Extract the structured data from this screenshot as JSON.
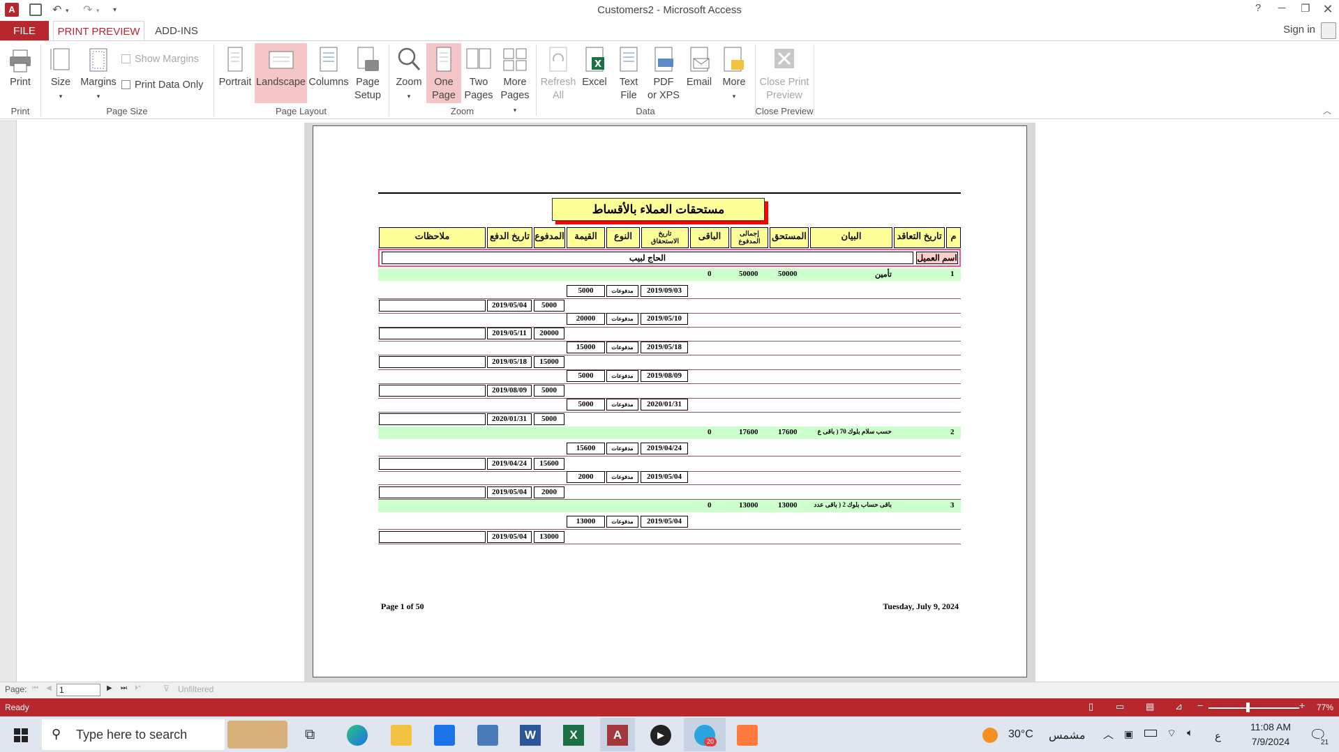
{
  "window": {
    "title": "Customers2 - Microsoft Access",
    "help": "?",
    "sign_in": "Sign in"
  },
  "tabs": [
    {
      "label": "FILE"
    },
    {
      "label": "PRINT PREVIEW"
    },
    {
      "label": "ADD-INS"
    }
  ],
  "ribbon": {
    "print": "Print",
    "size": "Size",
    "margins": "Margins",
    "show_margins": "Show Margins",
    "print_data_only": "Print Data Only",
    "portrait": "Portrait",
    "landscape": "Landscape",
    "columns": "Columns",
    "page_setup_1": "Page",
    "page_setup_2": "Setup",
    "zoom": "Zoom",
    "one_page_1": "One",
    "one_page_2": "Page",
    "two_pages_1": "Two",
    "two_pages_2": "Pages",
    "more_pages_1": "More",
    "more_pages_2": "Pages",
    "refresh_1": "Refresh",
    "refresh_2": "All",
    "excel": "Excel",
    "text_file_1": "Text",
    "text_file_2": "File",
    "pdf_1": "PDF",
    "pdf_2": "or XPS",
    "email": "Email",
    "more": "More",
    "close_1": "Close Print",
    "close_2": "Preview",
    "groups": {
      "print": "Print",
      "page_size": "Page Size",
      "page_layout": "Page Layout",
      "zoom": "Zoom",
      "data": "Data",
      "close_preview": "Close Preview"
    }
  },
  "report": {
    "title": "مستحقات العملاء بالأقساط",
    "headers": {
      "m": "م",
      "contract_date": "تاريخ التعاقد",
      "statement": "البيان",
      "due": "المستحق",
      "total_paid_1": "إجمالى",
      "total_paid_2": "المدفوع",
      "remaining": "الباقى",
      "due_date_1": "تاريخ",
      "due_date_2": "الاستحقاق",
      "type": "النوع",
      "value": "القيمة",
      "paid": "المدفوع",
      "pay_date": "تاريخ الدفع",
      "notes": "ملاحظات"
    },
    "customer_label": "اسم العميل",
    "customer_name": "الحاج لبيب",
    "groups": [
      {
        "num": "1",
        "desc": "تأمين",
        "due": "50000",
        "total_paid": "50000",
        "remaining": "0",
        "rows": [
          {
            "due_date": "2019/09/03",
            "type": "مدفوعات",
            "value": "5000",
            "paid": "5000",
            "pay_date": "2019/05/04"
          },
          {
            "due_date": "2019/05/10",
            "type": "مدفوعات",
            "value": "20000",
            "paid": "20000",
            "pay_date": "2019/05/11"
          },
          {
            "due_date": "2019/05/18",
            "type": "مدفوعات",
            "value": "15000",
            "paid": "15000",
            "pay_date": "2019/05/18"
          },
          {
            "due_date": "2019/08/09",
            "type": "مدفوعات",
            "value": "5000",
            "paid": "5000",
            "pay_date": "2019/08/09"
          },
          {
            "due_date": "2020/01/31",
            "type": "مدفوعات",
            "value": "5000",
            "paid": "5000",
            "pay_date": "2020/01/31"
          }
        ]
      },
      {
        "num": "2",
        "desc": "حسب سلام بلوك 70 ( باقى ع",
        "due": "17600",
        "total_paid": "17600",
        "remaining": "0",
        "rows": [
          {
            "due_date": "2019/04/24",
            "type": "مدفوعات",
            "value": "15600",
            "paid": "15600",
            "pay_date": "2019/04/24"
          },
          {
            "due_date": "2019/05/04",
            "type": "مدفوعات",
            "value": "2000",
            "paid": "2000",
            "pay_date": "2019/05/04"
          }
        ]
      },
      {
        "num": "3",
        "desc": "باقى حساب بلوك 2 ( باقى عدد",
        "due": "13000",
        "total_paid": "13000",
        "remaining": "0",
        "rows": [
          {
            "due_date": "2019/05/04",
            "type": "مدفوعات",
            "value": "13000",
            "paid": "13000",
            "pay_date": "2019/05/04"
          }
        ]
      }
    ],
    "footer_left": "Page 1 of 50",
    "footer_right": "Tuesday, July 9, 2024"
  },
  "navigation": {
    "page_label": "Page:",
    "page_value": "1",
    "filter": "Unfiltered"
  },
  "status": {
    "text": "Ready",
    "zoom": "77%",
    "zoom_fraction": 0.43
  },
  "taskbar": {
    "search_placeholder": "Type here to search",
    "weather_temp": "30°C",
    "weather_desc": "مشمس",
    "lang": "ع",
    "time": "11:08 AM",
    "date": "7/9/2024",
    "notifications": "21",
    "telegram_badge": "20"
  },
  "colors": {
    "accent": "#b7282e",
    "header_yellow": "#ffff99",
    "group_green": "#ccffcc",
    "title_shadow": "#ff0000"
  }
}
